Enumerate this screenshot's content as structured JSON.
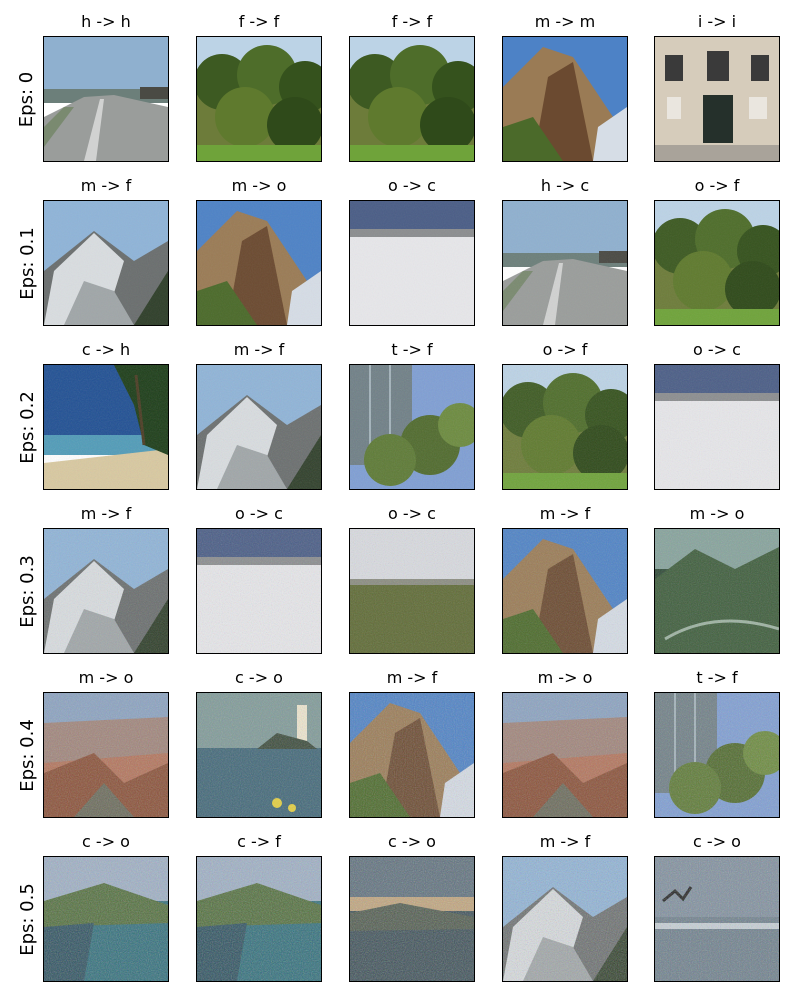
{
  "rows": [
    {
      "label": "Eps: 0",
      "cells": [
        {
          "title": "h -> h",
          "scene": "highway"
        },
        {
          "title": "f -> f",
          "scene": "forest"
        },
        {
          "title": "f -> f",
          "scene": "forest"
        },
        {
          "title": "m -> m",
          "scene": "mountain"
        },
        {
          "title": "i -> i",
          "scene": "building"
        }
      ]
    },
    {
      "label": "Eps: 0.1",
      "cells": [
        {
          "title": "m -> f",
          "scene": "snowy-mountain"
        },
        {
          "title": "m -> o",
          "scene": "mountain"
        },
        {
          "title": "o -> c",
          "scene": "salt-flat"
        },
        {
          "title": "h -> c",
          "scene": "highway"
        },
        {
          "title": "o -> f",
          "scene": "forest"
        }
      ]
    },
    {
      "label": "Eps: 0.2",
      "cells": [
        {
          "title": "c -> h",
          "scene": "beach"
        },
        {
          "title": "m -> f",
          "scene": "snowy-mountain"
        },
        {
          "title": "t -> f",
          "scene": "skyscraper"
        },
        {
          "title": "o -> f",
          "scene": "forest"
        },
        {
          "title": "o -> c",
          "scene": "salt-flat"
        }
      ]
    },
    {
      "label": "Eps: 0.3",
      "cells": [
        {
          "title": "m -> f",
          "scene": "snowy-mountain"
        },
        {
          "title": "o -> c",
          "scene": "salt-flat"
        },
        {
          "title": "o -> c",
          "scene": "field"
        },
        {
          "title": "m -> f",
          "scene": "mountain"
        },
        {
          "title": "m -> o",
          "scene": "valley"
        }
      ]
    },
    {
      "label": "Eps: 0.4",
      "cells": [
        {
          "title": "m -> o",
          "scene": "canyon"
        },
        {
          "title": "c -> o",
          "scene": "lighthouse"
        },
        {
          "title": "m -> f",
          "scene": "mountain"
        },
        {
          "title": "m -> o",
          "scene": "canyon"
        },
        {
          "title": "t -> f",
          "scene": "skyscraper"
        }
      ]
    },
    {
      "label": "Eps: 0.5",
      "cells": [
        {
          "title": "c -> o",
          "scene": "coast"
        },
        {
          "title": "c -> f",
          "scene": "coast"
        },
        {
          "title": "c -> o",
          "scene": "sunset-sea"
        },
        {
          "title": "m -> f",
          "scene": "snowy-mountain"
        },
        {
          "title": "c -> o",
          "scene": "sea-bird"
        }
      ]
    }
  ]
}
